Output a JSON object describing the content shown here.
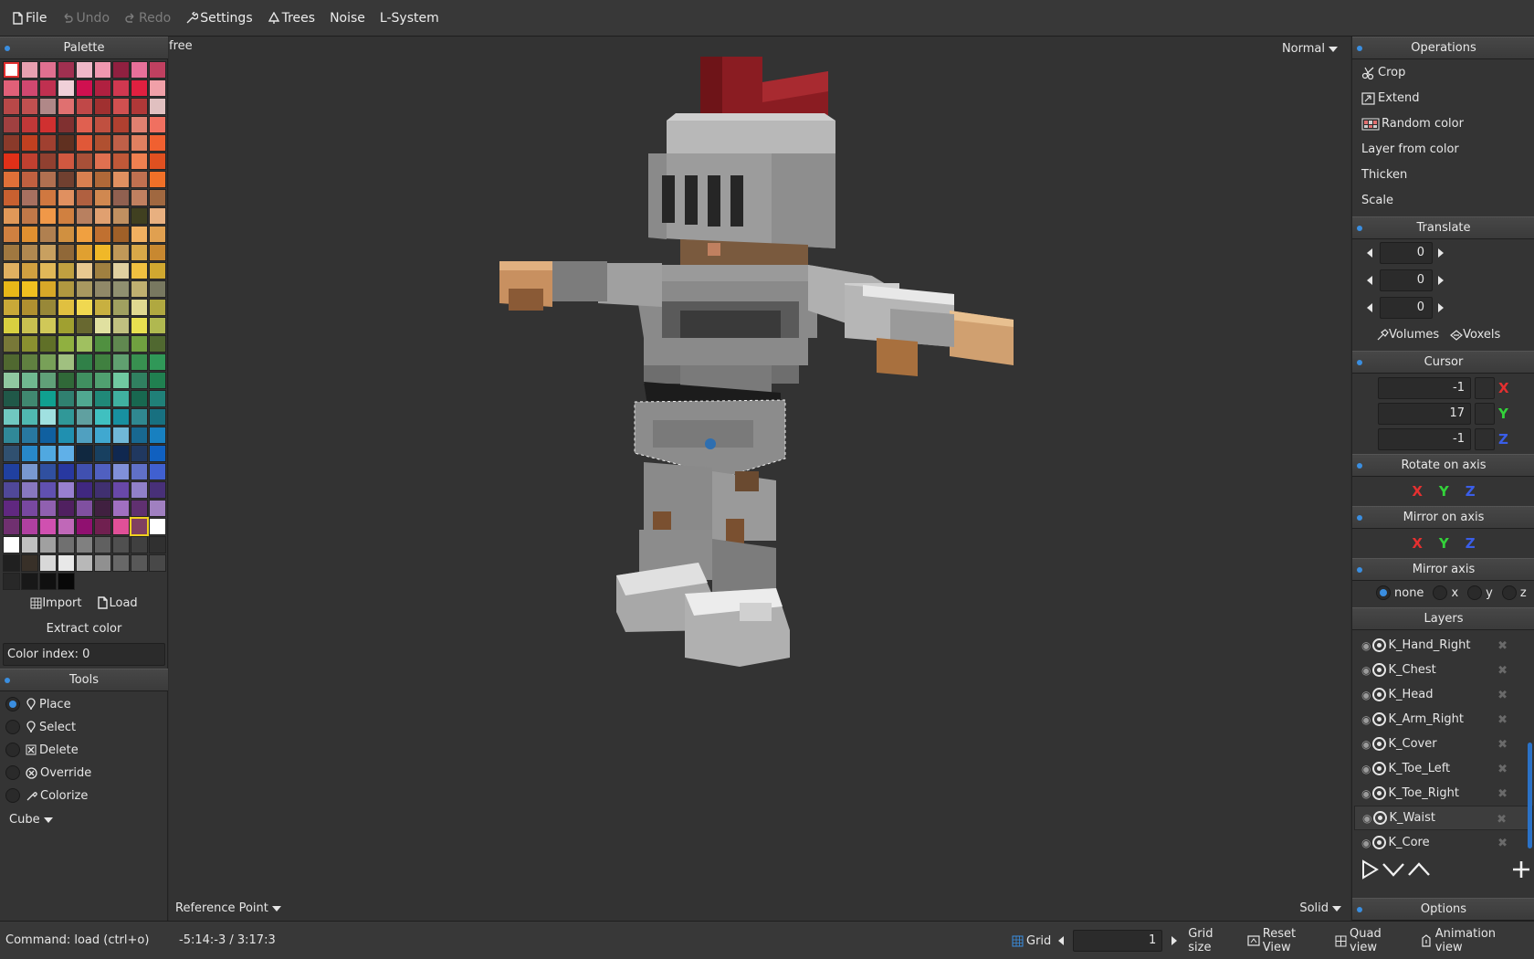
{
  "menubar": {
    "file": "File",
    "undo": "Undo",
    "redo": "Redo",
    "settings": "Settings",
    "trees": "Trees",
    "noise": "Noise",
    "lsystem": "L-System"
  },
  "palette": {
    "title": "Palette",
    "colors": [
      "#ffffff",
      "#e8a0b0",
      "#e07090",
      "#a03050",
      "#f0b8c8",
      "#f098b0",
      "#902040",
      "#e8709a",
      "#c04060",
      "#e06078",
      "#d04870",
      "#c03050",
      "#f0d0d8",
      "#d01050",
      "#b02040",
      "#d03850",
      "#e02040",
      "#f0a0a8",
      "#b84848",
      "#c05050",
      "#b08888",
      "#e07070",
      "#c04848",
      "#a03030",
      "#d05050",
      "#b03838",
      "#e0c0c0",
      "#a04040",
      "#c03838",
      "#d03030",
      "#803030",
      "#e06050",
      "#c05040",
      "#b04030",
      "#e08070",
      "#f07060",
      "#8a3a2a",
      "#c04020",
      "#a04030",
      "#603020",
      "#e05838",
      "#b05030",
      "#c06048",
      "#e08060",
      "#f06030",
      "#e03018",
      "#c04030",
      "#904030",
      "#d05840",
      "#a85038",
      "#e07050",
      "#c05838",
      "#f08050",
      "#e05020",
      "#e07038",
      "#c06040",
      "#b07050",
      "#704030",
      "#d88050",
      "#b06838",
      "#e09060",
      "#c07050",
      "#f07028",
      "#c86030",
      "#a87060",
      "#d07840",
      "#e09060",
      "#b06040",
      "#d08850",
      "#906050",
      "#c08060",
      "#a06840",
      "#e09858",
      "#c07848",
      "#f09848",
      "#d08040",
      "#b88060",
      "#e0a070",
      "#c09060",
      "#404020",
      "#e8b080",
      "#d08040",
      "#e09030",
      "#b08050",
      "#d09040",
      "#f0a040",
      "#c07030",
      "#a06028",
      "#f0b060",
      "#e0a050",
      "#a07840",
      "#b08850",
      "#c8a060",
      "#906838",
      "#e0a030",
      "#f0b828",
      "#c09858",
      "#d8a848",
      "#c88830",
      "#e0b060",
      "#d0a040",
      "#e0b858",
      "#c0a040",
      "#e8c890",
      "#a08040",
      "#e0d0a0",
      "#f0c040",
      "#d0a830",
      "#e8b818",
      "#f0c020",
      "#d8a828",
      "#b09840",
      "#a89860",
      "#908868",
      "#909070",
      "#c0b070",
      "#787860",
      "#c8a838",
      "#b09030",
      "#988838",
      "#e0c040",
      "#f0d850",
      "#c8b040",
      "#a0a060",
      "#e0d890",
      "#b0a840",
      "#d8d040",
      "#c8c050",
      "#d0c858",
      "#a0a030",
      "#686830",
      "#e0e0a0",
      "#c0c080",
      "#e8e050",
      "#b0b850",
      "#787838",
      "#8a9030",
      "#607028",
      "#90b040",
      "#a0c060",
      "#509040",
      "#608850",
      "#70a040",
      "#506830",
      "#506830",
      "#608040",
      "#78a058",
      "#a0c080",
      "#308048",
      "#408040",
      "#60a070",
      "#389050",
      "#309858",
      "#90c8a0",
      "#70b890",
      "#60a078",
      "#306838",
      "#409060",
      "#50a070",
      "#70c8a0",
      "#308060",
      "#208050",
      "#205848",
      "#408870",
      "#10a090",
      "#308070",
      "#50a890",
      "#208878",
      "#40b0a0",
      "#186850",
      "#208078",
      "#70c8c0",
      "#50b8b0",
      "#a0e0e0",
      "#309898",
      "#60a0a0",
      "#40c0c0",
      "#1890a0",
      "#308890",
      "#187080",
      "#308898",
      "#2878a0",
      "#1060a0",
      "#2090b0",
      "#50a0c0",
      "#40a8d0",
      "#70b8d8",
      "#186890",
      "#1880c0",
      "#305070",
      "#2888c8",
      "#50a8e0",
      "#60b0e8",
      "#102840",
      "#184060",
      "#102850",
      "#203860",
      "#1060c0",
      "#2040a0",
      "#7898d0",
      "#3050a0",
      "#2838a0",
      "#4050b0",
      "#5060c0",
      "#8090d8",
      "#6070c8",
      "#4060d0",
      "#504898",
      "#8878c0",
      "#6050b0",
      "#9880d0",
      "#402880",
      "#403070",
      "#6848a8",
      "#9080c8",
      "#483078",
      "#602880",
      "#7848a0",
      "#9060b0",
      "#502060",
      "#8050a0",
      "#402040",
      "#a070c0",
      "#603070",
      "#a080c0",
      "#703070",
      "#b040a0",
      "#d050b0",
      "#c068b8",
      "#901070",
      "#702050",
      "#e05098",
      "#804060",
      "#ffffff",
      "#ffffff",
      "#c0c0c0",
      "#a0a0a0",
      "#707070",
      "#808080",
      "#606060",
      "#505050",
      "#404040",
      "#303030",
      "#202020",
      "#383028",
      "#d8d8d8",
      "#e8e8e8",
      "#b8b8b8",
      "#909090",
      "#686868",
      "#585858",
      "#484848",
      "#282828",
      "#181818",
      "#101010",
      "#080808"
    ],
    "import_label": "Import",
    "load_label": "Load",
    "extract_label": "Extract color",
    "color_index": "Color index: 0"
  },
  "tools": {
    "title": "Tools",
    "items": [
      {
        "label": "Place",
        "selected": true
      },
      {
        "label": "Select",
        "selected": false
      },
      {
        "label": "Delete",
        "selected": false
      },
      {
        "label": "Override",
        "selected": false
      },
      {
        "label": "Colorize",
        "selected": false
      }
    ],
    "shape": "Cube"
  },
  "viewport": {
    "camera_mode": "free",
    "render_mode": "Normal",
    "reference_point": "Reference Point",
    "shading": "Solid"
  },
  "operations": {
    "title": "Operations",
    "items": [
      "Crop",
      "Extend",
      "Random color",
      "Layer from color",
      "Thicken",
      "Scale"
    ]
  },
  "translate": {
    "title": "Translate",
    "values": [
      "0",
      "0",
      "0"
    ],
    "volumes": "Volumes",
    "voxels": "Voxels"
  },
  "cursor": {
    "title": "Cursor",
    "x": "-1",
    "y": "17",
    "z": "-1",
    "x_label": "X",
    "y_label": "Y",
    "z_label": "Z"
  },
  "rotate": {
    "title": "Rotate on axis",
    "x": "X",
    "y": "Y",
    "z": "Z"
  },
  "mirror_on_axis": {
    "title": "Mirror on axis",
    "x": "X",
    "y": "Y",
    "z": "Z"
  },
  "mirror_axis": {
    "title": "Mirror axis",
    "options": [
      "none",
      "x",
      "y",
      "z"
    ],
    "selected": "none"
  },
  "layers": {
    "title": "Layers",
    "items": [
      {
        "name": "K_Hand_Right",
        "selected": false
      },
      {
        "name": "K_Chest",
        "selected": false
      },
      {
        "name": "K_Head",
        "selected": false
      },
      {
        "name": "K_Arm_Right",
        "selected": false
      },
      {
        "name": "K_Cover",
        "selected": false
      },
      {
        "name": "K_Toe_Left",
        "selected": false
      },
      {
        "name": "K_Toe_Right",
        "selected": false
      },
      {
        "name": "K_Waist",
        "selected": true
      },
      {
        "name": "K_Core",
        "selected": false
      }
    ]
  },
  "options": {
    "title": "Options"
  },
  "statusbar": {
    "command": "Command: load (ctrl+o)",
    "coords": "-5:14:-3 / 3:17:3",
    "grid_label": "Grid",
    "grid_value": "1",
    "grid_size": "Grid size",
    "reset_view": "Reset View",
    "quad_view": "Quad view",
    "animation_view": "Animation view"
  },
  "colors": {
    "accent": "#3a8ee0",
    "axis_x": "#e53030",
    "axis_y": "#33d23a",
    "axis_z": "#3a5ee8"
  }
}
